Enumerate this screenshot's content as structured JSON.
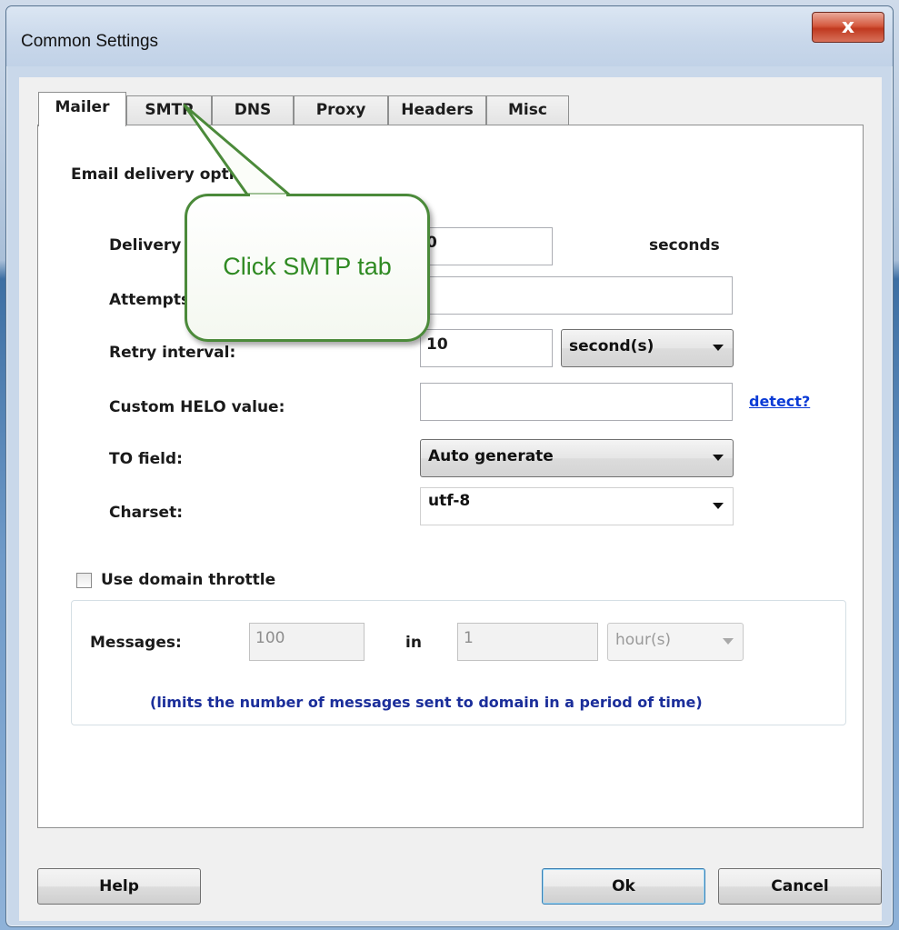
{
  "window": {
    "title": "Common Settings",
    "close_label": "x"
  },
  "tabs": [
    {
      "label": "Mailer",
      "active": true
    },
    {
      "label": "SMTP",
      "active": false
    },
    {
      "label": "DNS",
      "active": false
    },
    {
      "label": "Proxy",
      "active": false
    },
    {
      "label": "Headers",
      "active": false
    },
    {
      "label": "Misc",
      "active": false
    }
  ],
  "mailer": {
    "section_title": "Email delivery options",
    "delivery_label": "Delivery timeout:",
    "delivery_value": "0",
    "delivery_unit": "seconds",
    "attempts_label": "Attempts:",
    "attempts_value": "",
    "retry_label": "Retry interval:",
    "retry_value": "10",
    "retry_unit": "second(s)",
    "helo_label": "Custom HELO value:",
    "helo_value": "",
    "helo_link": "detect?",
    "to_label": "TO field:",
    "to_value": "Auto generate",
    "charset_label": "Charset:",
    "charset_value": "utf-8"
  },
  "throttle": {
    "checkbox_label": "Use domain throttle",
    "checked": false,
    "messages_label": "Messages:",
    "messages_value": "100",
    "in_label": "in",
    "period_value": "1",
    "period_unit": "hour(s)",
    "hint": "(limits the number of messages sent to domain in a period of time)"
  },
  "buttons": {
    "help": "Help",
    "ok": "Ok",
    "cancel": "Cancel"
  },
  "callout": {
    "text": "Click SMTP tab",
    "border_color": "#4b8a3a",
    "text_color": "#2f8a22"
  }
}
